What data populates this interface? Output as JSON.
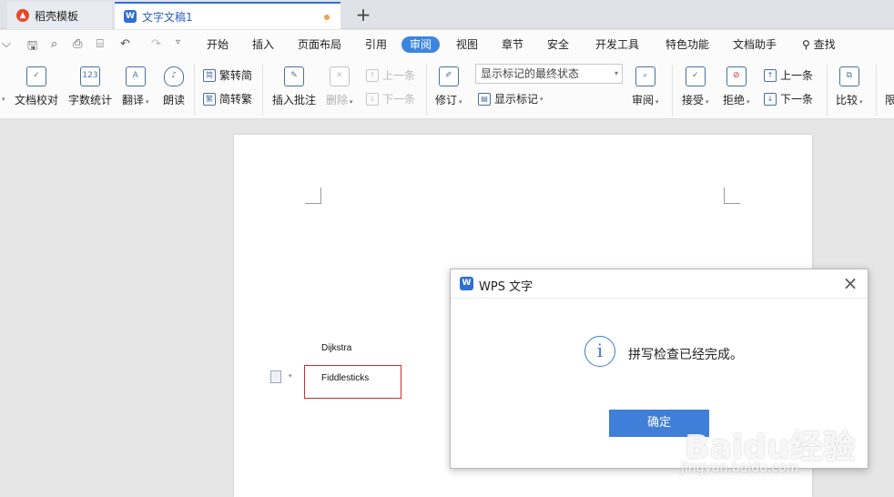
{
  "tabs": [
    {
      "label": "稻壳模板"
    },
    {
      "label": "文字文稿1"
    }
  ],
  "menu": [
    "开始",
    "插入",
    "页面布局",
    "引用",
    "审阅",
    "视图",
    "章节",
    "安全",
    "开发工具",
    "特色功能",
    "文档助手",
    "查找"
  ],
  "active_menu": "审阅",
  "ribbon": {
    "proofread": "文档校对",
    "wordcount": "字数统计",
    "wordcount_icon": "123",
    "translate": "翻译",
    "read_aloud": "朗读",
    "trad": "繁转简",
    "simp": "简转繁",
    "insert_comment": "插入批注",
    "delete": "删除",
    "prev_comment": "上一条",
    "next_comment": "下一条",
    "track": "修订",
    "markup_state": "显示标记的最终状态",
    "show_markup": "显示标记",
    "review": "审阅",
    "accept": "接受",
    "reject": "拒绝",
    "prev_change": "上一条",
    "next_change": "下一条",
    "compare": "比较",
    "cutoff": "限"
  },
  "document": {
    "word1": "Dijkstra",
    "word2": "Fiddlesticks"
  },
  "dialog": {
    "title": "WPS 文字",
    "message": "拼写检查已经完成。",
    "ok": "确定"
  },
  "watermark": {
    "brand": "Baidu经验",
    "url": "jingyan.baidu.com"
  },
  "colors": {
    "accent": "#3c86e0",
    "error_box": "#d12a2a",
    "button": "#3f7fd9"
  }
}
